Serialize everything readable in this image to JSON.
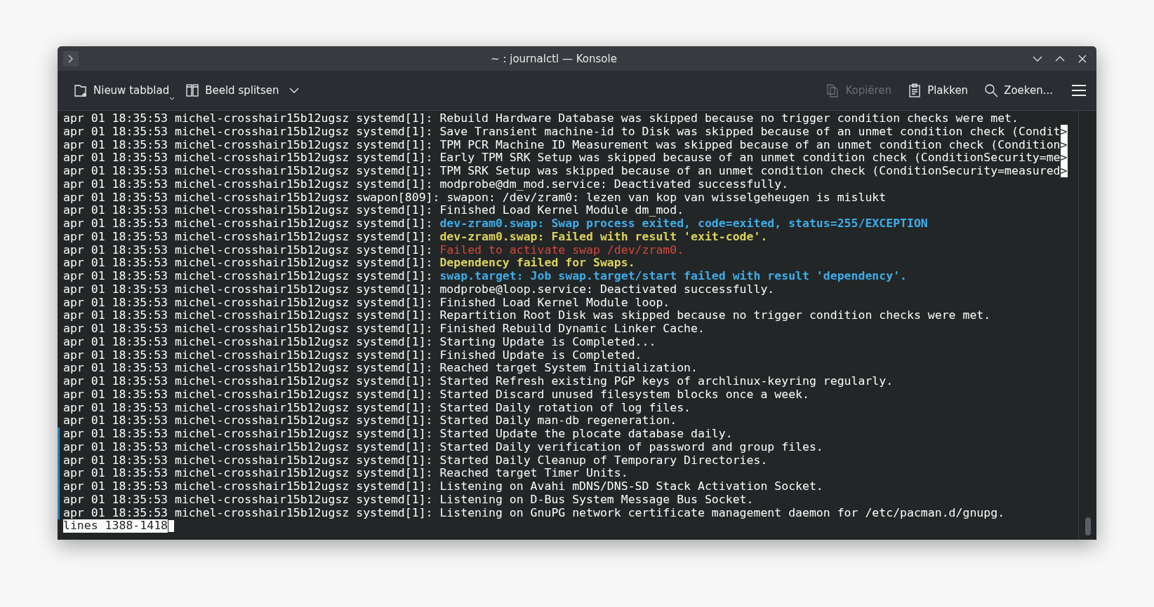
{
  "window": {
    "title": "~ : journalctl — Konsole"
  },
  "toolbar": {
    "left": [
      {
        "label": "Nieuw tabblad",
        "kind": "newtab",
        "disabled": false
      },
      {
        "label": "Beeld splitsen",
        "kind": "split",
        "disabled": false
      }
    ],
    "right": [
      {
        "label": "Kopiëren",
        "kind": "copy",
        "disabled": true
      },
      {
        "label": "Plakken",
        "kind": "paste",
        "disabled": false
      },
      {
        "label": "Zoeken...",
        "kind": "search",
        "disabled": false
      }
    ]
  },
  "log": [
    {
      "prefix": "apr 01 18:35:53 michel-crosshair15b12ugsz systemd[1]: ",
      "message": "Rebuild Hardware Database was skipped because no trigger condition checks were met.",
      "kind": "normal",
      "marked": false
    },
    {
      "prefix": "apr 01 18:35:53 michel-crosshair15b12ugsz systemd[1]: ",
      "message": "Save Transient machine-id to Disk was skipped because of an unmet condition check (Condit",
      "cut_mark": ">",
      "kind": "normal",
      "marked": false
    },
    {
      "prefix": "apr 01 18:35:53 michel-crosshair15b12ugsz systemd[1]: ",
      "message": "TPM PCR Machine ID Measurement was skipped because of an unmet condition check (Condition",
      "cut_mark": ">",
      "kind": "normal",
      "marked": false
    },
    {
      "prefix": "apr 01 18:35:53 michel-crosshair15b12ugsz systemd[1]: ",
      "message": "Early TPM SRK Setup was skipped because of an unmet condition check (ConditionSecurity=me",
      "cut_mark": ">",
      "kind": "normal",
      "marked": false
    },
    {
      "prefix": "apr 01 18:35:53 michel-crosshair15b12ugsz systemd[1]: ",
      "message": "TPM SRK Setup was skipped because of an unmet condition check (ConditionSecurity=measured",
      "cut_mark": ">",
      "kind": "normal",
      "marked": false
    },
    {
      "prefix": "apr 01 18:35:53 michel-crosshair15b12ugsz systemd[1]: ",
      "message": "modprobe@dm_mod.service: Deactivated successfully.",
      "kind": "normal",
      "marked": false
    },
    {
      "prefix": "apr 01 18:35:53 michel-crosshair15b12ugsz swapon[809]: ",
      "message": "swapon: /dev/zram0: lezen van kop van wisselgeheugen is mislukt",
      "kind": "normal",
      "marked": false
    },
    {
      "prefix": "apr 01 18:35:53 michel-crosshair15b12ugsz systemd[1]: ",
      "message": "Finished Load Kernel Module dm_mod.",
      "kind": "normal",
      "marked": false
    },
    {
      "prefix": "apr 01 18:35:53 michel-crosshair15b12ugsz systemd[1]: ",
      "message": "dev-zram0.swap: Swap process exited, code=exited, status=255/EXCEPTION",
      "kind": "notice",
      "marked": false
    },
    {
      "prefix": "apr 01 18:35:53 michel-crosshair15b12ugsz systemd[1]: ",
      "message": "dev-zram0.swap: Failed with result 'exit-code'.",
      "kind": "warning",
      "marked": false
    },
    {
      "prefix": "apr 01 18:35:53 michel-crosshair15b12ugsz systemd[1]: ",
      "message": "Failed to activate swap /dev/zram0.",
      "kind": "error",
      "marked": false
    },
    {
      "prefix": "apr 01 18:35:53 michel-crosshair15b12ugsz systemd[1]: ",
      "message": "Dependency failed for Swaps.",
      "kind": "warning",
      "marked": false
    },
    {
      "prefix": "apr 01 18:35:53 michel-crosshair15b12ugsz systemd[1]: ",
      "message": "swap.target: Job swap.target/start failed with result 'dependency'.",
      "kind": "notice",
      "marked": false
    },
    {
      "prefix": "apr 01 18:35:53 michel-crosshair15b12ugsz systemd[1]: ",
      "message": "modprobe@loop.service: Deactivated successfully.",
      "kind": "normal",
      "marked": false
    },
    {
      "prefix": "apr 01 18:35:53 michel-crosshair15b12ugsz systemd[1]: ",
      "message": "Finished Load Kernel Module loop.",
      "kind": "normal",
      "marked": false
    },
    {
      "prefix": "apr 01 18:35:53 michel-crosshair15b12ugsz systemd[1]: ",
      "message": "Repartition Root Disk was skipped because no trigger condition checks were met.",
      "kind": "normal",
      "marked": false
    },
    {
      "prefix": "apr 01 18:35:53 michel-crosshair15b12ugsz systemd[1]: ",
      "message": "Finished Rebuild Dynamic Linker Cache.",
      "kind": "normal",
      "marked": false
    },
    {
      "prefix": "apr 01 18:35:53 michel-crosshair15b12ugsz systemd[1]: ",
      "message": "Starting Update is Completed...",
      "kind": "normal",
      "marked": false
    },
    {
      "prefix": "apr 01 18:35:53 michel-crosshair15b12ugsz systemd[1]: ",
      "message": "Finished Update is Completed.",
      "kind": "normal",
      "marked": false
    },
    {
      "prefix": "apr 01 18:35:53 michel-crosshair15b12ugsz systemd[1]: ",
      "message": "Reached target System Initialization.",
      "kind": "normal",
      "marked": false
    },
    {
      "prefix": "apr 01 18:35:53 michel-crosshair15b12ugsz systemd[1]: ",
      "message": "Started Refresh existing PGP keys of archlinux-keyring regularly.",
      "kind": "normal",
      "marked": false
    },
    {
      "prefix": "apr 01 18:35:53 michel-crosshair15b12ugsz systemd[1]: ",
      "message": "Started Discard unused filesystem blocks once a week.",
      "kind": "normal",
      "marked": false
    },
    {
      "prefix": "apr 01 18:35:53 michel-crosshair15b12ugsz systemd[1]: ",
      "message": "Started Daily rotation of log files.",
      "kind": "normal",
      "marked": false
    },
    {
      "prefix": "apr 01 18:35:53 michel-crosshair15b12ugsz systemd[1]: ",
      "message": "Started Daily man-db regeneration.",
      "kind": "normal",
      "marked": false
    },
    {
      "prefix": "apr 01 18:35:53 michel-crosshair15b12ugsz systemd[1]: ",
      "message": "Started Update the plocate database daily.",
      "kind": "normal",
      "marked": true
    },
    {
      "prefix": "apr 01 18:35:53 michel-crosshair15b12ugsz systemd[1]: ",
      "message": "Started Daily verification of password and group files.",
      "kind": "normal",
      "marked": true
    },
    {
      "prefix": "apr 01 18:35:53 michel-crosshair15b12ugsz systemd[1]: ",
      "message": "Started Daily Cleanup of Temporary Directories.",
      "kind": "normal",
      "marked": true
    },
    {
      "prefix": "apr 01 18:35:53 michel-crosshair15b12ugsz systemd[1]: ",
      "message": "Reached target Timer Units.",
      "kind": "normal",
      "marked": true
    },
    {
      "prefix": "apr 01 18:35:53 michel-crosshair15b12ugsz systemd[1]: ",
      "message": "Listening on Avahi mDNS/DNS-SD Stack Activation Socket.",
      "kind": "normal",
      "marked": true
    },
    {
      "prefix": "apr 01 18:35:53 michel-crosshair15b12ugsz systemd[1]: ",
      "message": "Listening on D-Bus System Message Bus Socket.",
      "kind": "normal",
      "marked": true
    },
    {
      "prefix": "apr 01 18:35:53 michel-crosshair15b12ugsz systemd[1]: ",
      "message": "Listening on GnuPG network certificate management daemon for /etc/pacman.d/gnupg.",
      "kind": "normal",
      "marked": true
    }
  ],
  "pager_status": "lines 1388-1418"
}
